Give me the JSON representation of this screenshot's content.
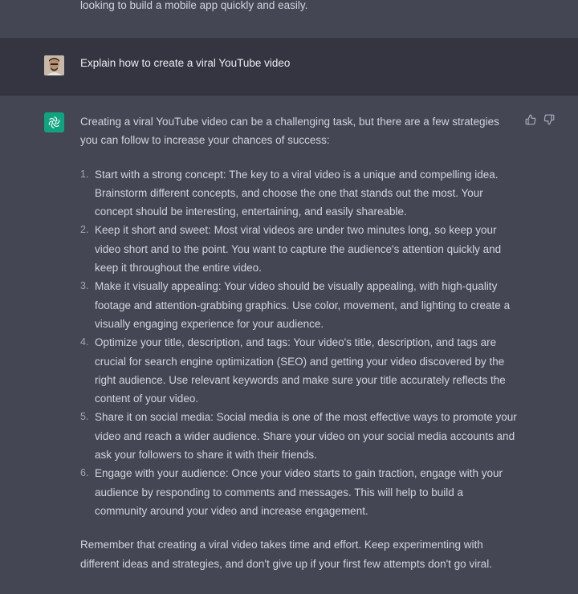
{
  "previous_message": {
    "text": "looking to build a mobile app quickly and easily."
  },
  "user_message": {
    "text": "Explain how to create a viral YouTube video"
  },
  "assistant_message": {
    "intro": "Creating a viral YouTube video can be a challenging task, but there are a few strategies you can follow to increase your chances of success:",
    "steps": [
      "Start with a strong concept: The key to a viral video is a unique and compelling idea. Brainstorm different concepts, and choose the one that stands out the most. Your concept should be interesting, entertaining, and easily shareable.",
      "Keep it short and sweet: Most viral videos are under two minutes long, so keep your video short and to the point. You want to capture the audience's attention quickly and keep it throughout the entire video.",
      "Make it visually appealing: Your video should be visually appealing, with high-quality footage and attention-grabbing graphics. Use color, movement, and lighting to create a visually engaging experience for your audience.",
      "Optimize your title, description, and tags: Your video's title, description, and tags are crucial for search engine optimization (SEO) and getting your video discovered by the right audience. Use relevant keywords and make sure your title accurately reflects the content of your video.",
      "Share it on social media: Social media is one of the most effective ways to promote your video and reach a wider audience. Share your video on your social media accounts and ask your followers to share it with their friends.",
      "Engage with your audience: Once your video starts to gain traction, engage with your audience by responding to comments and messages. This will help to build a community around your video and increase engagement."
    ],
    "closing": "Remember that creating a viral video takes time and effort. Keep experimenting with different ideas and strategies, and don't give up if your first few attempts don't go viral."
  },
  "icons": {
    "assistant_avatar": "openai-logo-icon",
    "user_avatar": "user-avatar",
    "thumbs_up": "thumbs-up-icon",
    "thumbs_down": "thumbs-down-icon"
  },
  "colors": {
    "assistant_bg": "#444654",
    "user_bg": "#343541",
    "brand": "#10a37f",
    "text": "#d1d5db"
  }
}
